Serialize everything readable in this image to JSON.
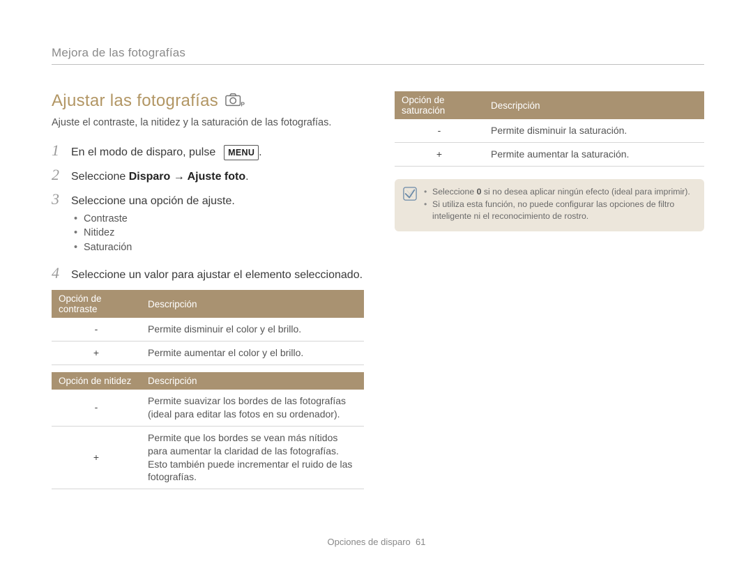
{
  "breadcrumb": "Mejora de las fotografías",
  "heading": "Ajustar las fotografías",
  "icon_name": "camera-p-icon",
  "intro": "Ajuste el contraste, la nitidez y la saturación de las fotografías.",
  "steps": [
    {
      "num": "1",
      "parts": {
        "pre": "En el modo de disparo, pulse ",
        "key": "MENU",
        "post": "."
      }
    },
    {
      "num": "2",
      "parts": {
        "pre": "Seleccione ",
        "bold": "Disparo → Ajuste foto",
        "post": "."
      }
    },
    {
      "num": "3",
      "parts": {
        "text": "Seleccione una opción de ajuste."
      },
      "bullets": [
        "Contraste",
        "Nitidez",
        "Saturación"
      ]
    },
    {
      "num": "4",
      "parts": {
        "text": "Seleccione un valor para ajustar el elemento seleccionado."
      }
    }
  ],
  "tables": {
    "contrast": {
      "headers": [
        "Opción de contraste",
        "Descripción"
      ],
      "rows": [
        [
          "-",
          "Permite disminuir el color y el brillo."
        ],
        [
          "+",
          "Permite aumentar el color y el brillo."
        ]
      ]
    },
    "sharpness": {
      "headers": [
        "Opción de nitidez",
        "Descripción"
      ],
      "rows": [
        [
          "-",
          "Permite suavizar los bordes de las fotografías (ideal para editar las fotos en su ordenador)."
        ],
        [
          "+",
          "Permite que los bordes se vean más nítidos para aumentar la claridad de las fotografías. Esto también puede incrementar el ruido de las fotografías."
        ]
      ]
    },
    "saturation": {
      "headers": [
        "Opción de saturación",
        "Descripción"
      ],
      "rows": [
        [
          "-",
          "Permite disminuir la saturación."
        ],
        [
          "+",
          "Permite aumentar la saturación."
        ]
      ]
    }
  },
  "info": {
    "items": [
      {
        "pre": "Seleccione ",
        "bold": "0",
        "post": " si no desea aplicar ningún efecto (ideal para imprimir)."
      },
      {
        "text": "Si utiliza esta función, no puede configurar las opciones de filtro inteligente ni el reconocimiento de rostro."
      }
    ]
  },
  "footer": {
    "section": "Opciones de disparo",
    "page": "61"
  }
}
